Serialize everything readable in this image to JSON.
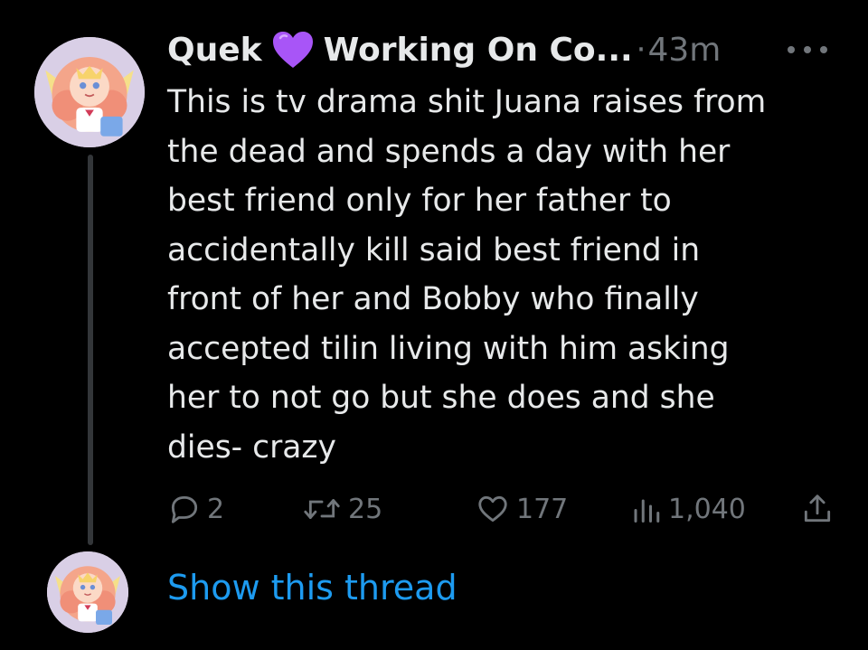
{
  "tweet": {
    "display_name": "Quek",
    "emoji": "purple-heart",
    "handle": "Working On Co...",
    "separator": "·",
    "time": "43m",
    "text": "This is tv drama shit Juana raises from\nthe dead and spends a day with her\nbest friend only for her father to\naccidentally kill said best friend in\nfront of her and Bobby who finally\naccepted tilin living with him asking\nher to not go but she does and she\ndies- crazy",
    "metrics": {
      "replies": "2",
      "retweets": "25",
      "likes": "177",
      "views": "1,040"
    }
  },
  "thread": {
    "show_label": "Show this thread"
  },
  "colors": {
    "background": "#000000",
    "text": "#e7e9ea",
    "muted": "#71767b",
    "link": "#1d9bf0",
    "thread_line": "#333639",
    "emoji": "#a855f7"
  },
  "icons": [
    "more-icon",
    "reply-icon",
    "retweet-icon",
    "like-icon",
    "views-icon",
    "share-icon",
    "purple-heart-icon"
  ]
}
